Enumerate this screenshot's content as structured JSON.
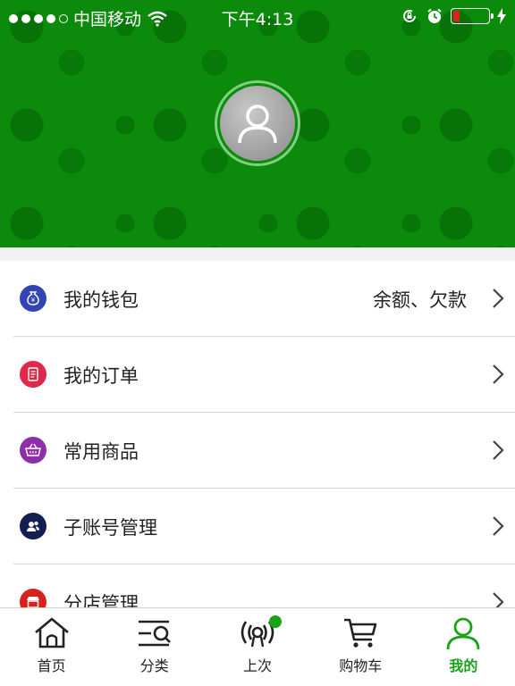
{
  "status_bar": {
    "carrier": "中国移动",
    "time": "下午4:13"
  },
  "profile": {
    "avatar_icon": "user-icon"
  },
  "menu": [
    {
      "label": "我的钱包",
      "value": "余额、欠款",
      "icon": "wallet-icon",
      "icon_color": "#3345b5"
    },
    {
      "label": "我的订单",
      "value": "",
      "icon": "order-icon",
      "icon_color": "#e0284b"
    },
    {
      "label": "常用商品",
      "value": "",
      "icon": "basket-icon",
      "icon_color": "#8e2fa8"
    },
    {
      "label": "子账号管理",
      "value": "",
      "icon": "sub-account-icon",
      "icon_color": "#141e50"
    },
    {
      "label": "分店管理",
      "value": "",
      "icon": "store-icon",
      "icon_color": "#d8231c"
    }
  ],
  "tabbar": {
    "active_color": "#19a319",
    "tabs": [
      {
        "label": "首页",
        "icon": "home-icon"
      },
      {
        "label": "分类",
        "icon": "category-search-icon"
      },
      {
        "label": "上次",
        "icon": "last-order-icon"
      },
      {
        "label": "购物车",
        "icon": "cart-icon"
      },
      {
        "label": "我的",
        "icon": "profile-icon"
      }
    ]
  }
}
